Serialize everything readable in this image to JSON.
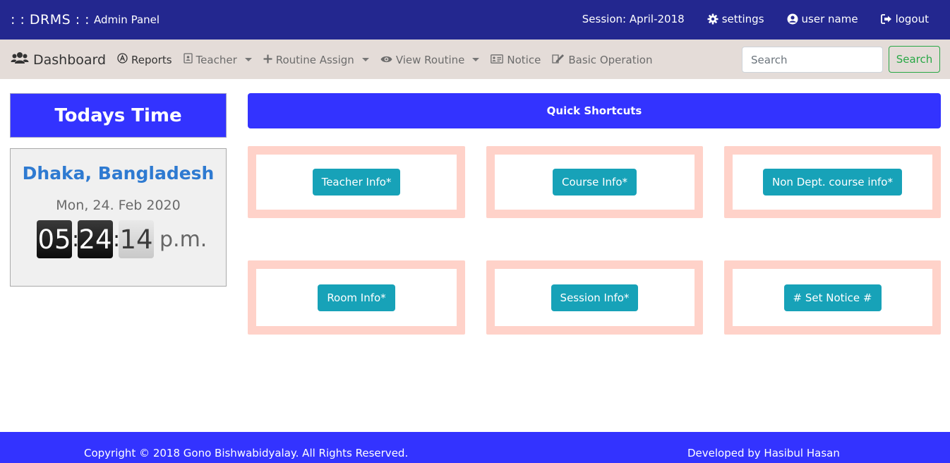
{
  "topbar": {
    "brand": ": : DRMS : :",
    "panel": "Admin Panel",
    "session": "Session: April-2018",
    "settings": "settings",
    "user": "user name",
    "logout": "logout"
  },
  "navbar": {
    "dashboard": "Dashboard",
    "items": [
      {
        "label": "Reports",
        "icon": "reports-icon",
        "dropdown": false
      },
      {
        "label": "Teacher",
        "icon": "teacher-icon",
        "dropdown": true
      },
      {
        "label": "Routine Assign",
        "icon": "plus-icon",
        "dropdown": true
      },
      {
        "label": "View Routine",
        "icon": "eye-icon",
        "dropdown": true
      },
      {
        "label": "Notice",
        "icon": "notice-icon",
        "dropdown": false
      },
      {
        "label": "Basic Operation",
        "icon": "edit-icon",
        "dropdown": false
      }
    ],
    "search_placeholder": "Search",
    "search_button": "Search"
  },
  "time_panel": {
    "title": "Todays Time",
    "city": "Dhaka, Bangladesh",
    "date": "Mon, 24. Feb 2020",
    "hours": "05",
    "minutes": "24",
    "seconds": "14",
    "ampm": "p.m."
  },
  "shortcuts": {
    "title": "Quick Shortcuts",
    "buttons": [
      "Teacher Info*",
      "Course Info*",
      "Non Dept. course info*",
      "Room Info*",
      "Session Info*",
      "# Set Notice #"
    ]
  },
  "footer": {
    "copyright": "Copyright © 2018 Gono Bishwabidyalay. All Rights Reserved.",
    "developer": "Developed by Hasibul Hasan"
  },
  "colors": {
    "topbar": "#23278f",
    "accent": "#3333ff",
    "shortcut_button": "#17a2b8",
    "card_border": "#ffd2c9",
    "search_green": "#28a745"
  }
}
